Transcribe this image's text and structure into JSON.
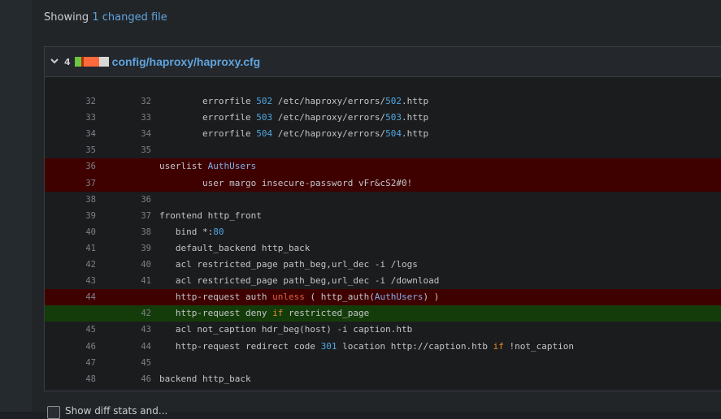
{
  "summary": {
    "prefix": "Showing",
    "link": "1 changed file"
  },
  "file": {
    "changes_count": "4",
    "path": "config/haproxy/haproxy.cfg",
    "stat_colors": [
      "#6cc644",
      "#bd2c00",
      "#ff6a3d",
      "#d8d8d8"
    ]
  },
  "lines": [
    {
      "old": "",
      "new": "",
      "type": "ctx",
      "code": ""
    },
    {
      "old": "32",
      "new": "32",
      "type": "ctx",
      "code": "        errorfile 502 /etc/haproxy/errors/502.http"
    },
    {
      "old": "33",
      "new": "33",
      "type": "ctx",
      "code": "        errorfile 503 /etc/haproxy/errors/503.http"
    },
    {
      "old": "34",
      "new": "34",
      "type": "ctx",
      "code": "        errorfile 504 /etc/haproxy/errors/504.http"
    },
    {
      "old": "35",
      "new": "35",
      "type": "ctx",
      "code": ""
    },
    {
      "old": "36",
      "new": "",
      "type": "del",
      "code": "userlist AuthUsers"
    },
    {
      "old": "37",
      "new": "",
      "type": "del",
      "code": "        user margo insecure-password vFr&cS2#0!"
    },
    {
      "old": "38",
      "new": "36",
      "type": "ctx",
      "code": ""
    },
    {
      "old": "39",
      "new": "37",
      "type": "ctx",
      "code": "frontend http_front"
    },
    {
      "old": "40",
      "new": "38",
      "type": "ctx",
      "code": "   bind *:80"
    },
    {
      "old": "41",
      "new": "39",
      "type": "ctx",
      "code": "   default_backend http_back"
    },
    {
      "old": "42",
      "new": "40",
      "type": "ctx",
      "code": "   acl restricted_page path_beg,url_dec -i /logs"
    },
    {
      "old": "43",
      "new": "41",
      "type": "ctx",
      "code": "   acl restricted_page path_beg,url_dec -i /download"
    },
    {
      "old": "44",
      "new": "",
      "type": "del",
      "code": "   http-request auth unless ( http_auth(AuthUsers) )"
    },
    {
      "old": "",
      "new": "42",
      "type": "add",
      "code": "   http-request deny if restricted_page"
    },
    {
      "old": "45",
      "new": "43",
      "type": "ctx",
      "code": "   acl not_caption hdr_beg(host) -i caption.htb"
    },
    {
      "old": "46",
      "new": "44",
      "type": "ctx",
      "code": "   http-request redirect code 301 location http://caption.htb if !not_caption"
    },
    {
      "old": "47",
      "new": "45",
      "type": "ctx",
      "code": ""
    },
    {
      "old": "48",
      "new": "46",
      "type": "ctx",
      "code": "backend http_back"
    }
  ],
  "footer_text": "Show diff stats and..."
}
